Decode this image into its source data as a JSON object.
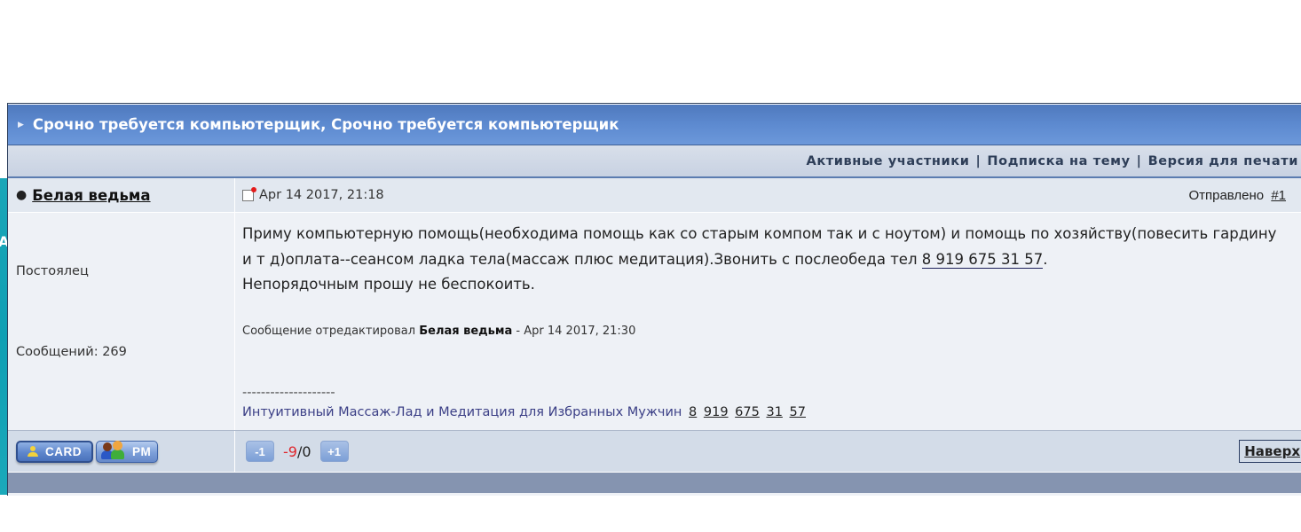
{
  "topic": {
    "title": "Срочно требуется компьютерщик, Срочно требуется компьютерщик",
    "arrow_icon": "triangle-right-icon"
  },
  "subbar": {
    "links": [
      "Активные участники",
      "Подписка на тему",
      "Версия для печати"
    ],
    "separator": "|"
  },
  "post": {
    "author": "Белая ведьма",
    "online_marker": "●",
    "date": "Apr 14 2017, 21:18",
    "sent_label": "Отправлено",
    "post_number": "#1",
    "author_rank": "Постоялец",
    "post_count_label": "Сообщений: 269",
    "message": {
      "text_before_phone": "Приму компьютерную помощь(необходима помощь как со старым компом так и с ноутом) и помощь по хозяйству(повесить гардину и т д)оплата--сеансом ладка тела(массаж плюс медитация).Звонить с послеобеда тел ",
      "phone": "8 919 675 31 57",
      "text_after_phone": ".",
      "last_line": "Непорядочным прошу не беспокоить."
    },
    "edited": {
      "prefix": "Сообщение отредактировал",
      "editor": "Белая ведьма",
      "suffix": "- Apr 14 2017, 21:30"
    },
    "signature": {
      "separator_line": "--------------------",
      "text": "Интуитивный Массаж-Лад и Медитация для Избранных Мужчин",
      "phone_parts": [
        "8",
        "919",
        "675",
        "31",
        "57"
      ]
    }
  },
  "footer": {
    "card_label": "CARD",
    "pm_label": "PM",
    "vote_down": "-1",
    "vote_up": "+1",
    "score_negative": "-9",
    "score_separator": "/",
    "score_positive": "0",
    "to_top_label": "Наверх"
  },
  "colors": {
    "header_blue": "#5d8ad0",
    "negative_score": "#e0252b",
    "signature_text": "#3b3f86",
    "teal_background": "#0f9fb4"
  }
}
